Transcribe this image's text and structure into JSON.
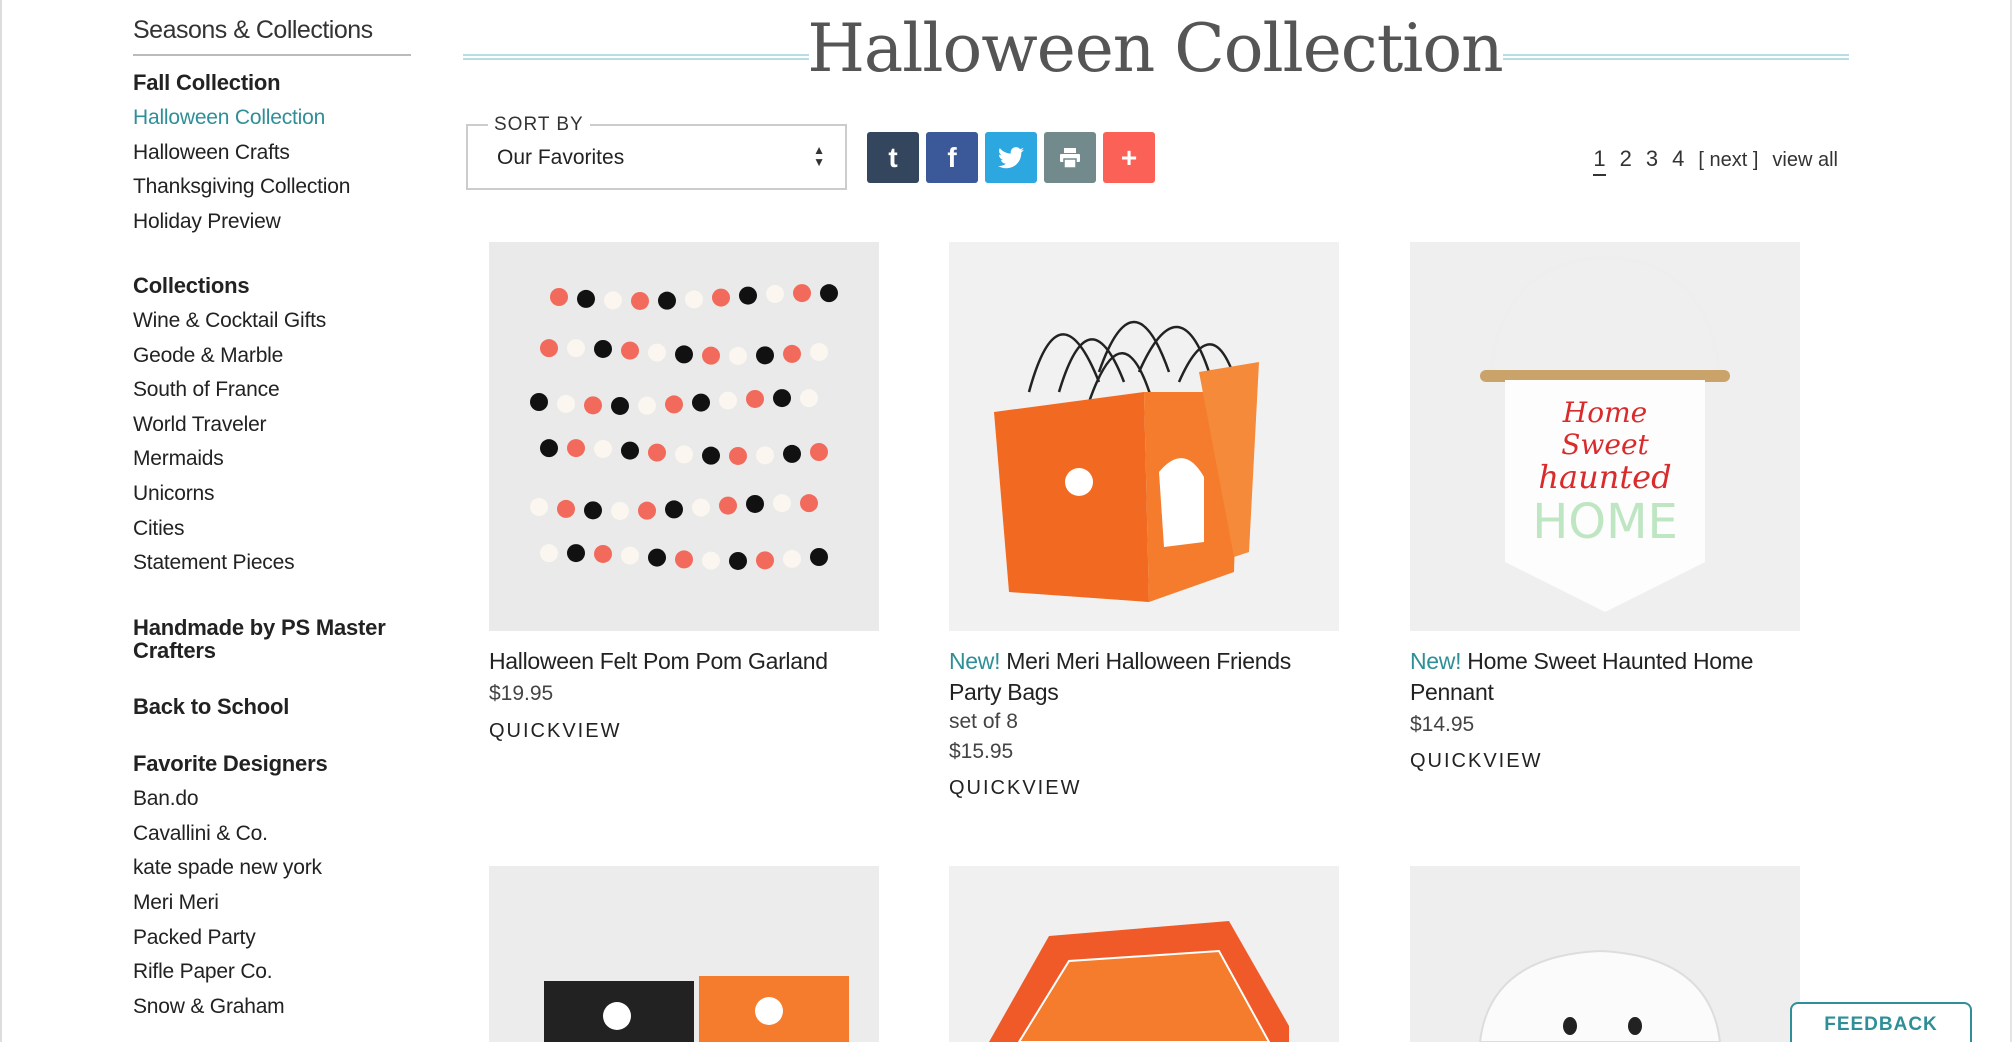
{
  "sidebar": {
    "title": "Seasons & Collections",
    "fall": {
      "heading": "Fall Collection",
      "items": [
        "Halloween Collection",
        "Halloween Crafts",
        "Thanksgiving Collection",
        "Holiday Preview"
      ]
    },
    "collections": {
      "heading": "Collections",
      "items": [
        "Wine & Cocktail Gifts",
        "Geode & Marble",
        "South of France",
        "World Traveler",
        "Mermaids",
        "Unicorns",
        "Cities",
        "Statement Pieces"
      ]
    },
    "handmade": "Handmade by PS Master Crafters",
    "back_to_school": "Back to School",
    "designers": {
      "heading": "Favorite Designers",
      "items": [
        "Ban.do",
        "Cavallini & Co.",
        "kate spade new york",
        "Meri Meri",
        "Packed Party",
        "Rifle Paper Co.",
        "Snow & Graham"
      ]
    },
    "active_item": "Halloween Collection"
  },
  "main": {
    "title": "Halloween Collection",
    "sort": {
      "label": "SORT BY",
      "value": "Our Favorites"
    },
    "share": [
      {
        "icon": "tumblr-icon",
        "glyph": "t",
        "color": "#34465d"
      },
      {
        "icon": "facebook-icon",
        "glyph": "f",
        "color": "#3b5998"
      },
      {
        "icon": "twitter-icon",
        "glyph": "",
        "color": "#2ca7e0"
      },
      {
        "icon": "print-icon",
        "glyph": "",
        "color": "#738a8d"
      },
      {
        "icon": "plus-icon",
        "glyph": "+",
        "color": "#fc6157"
      }
    ],
    "pagination": {
      "pages": [
        "1",
        "2",
        "3",
        "4"
      ],
      "current": "1",
      "next": "[ next ]",
      "view_all": "view all"
    },
    "new_label": "New!",
    "quickview": "QUICKVIEW",
    "products": [
      {
        "title": "Halloween Felt Pom Pom Garland",
        "price": "$19.95",
        "new": false
      },
      {
        "title": "Meri Meri Halloween Friends Party Bags",
        "sub": "set of 8",
        "price": "$15.95",
        "new": true
      },
      {
        "title": "Home Sweet Haunted Home Pennant",
        "price": "$14.95",
        "new": true
      }
    ],
    "pennant_text": [
      "Home",
      "Sweet",
      "haunted",
      "HOME"
    ]
  },
  "feedback": "FEEDBACK",
  "colors": {
    "accent": "#2f8f98",
    "title_rule": "#b7dde0"
  }
}
